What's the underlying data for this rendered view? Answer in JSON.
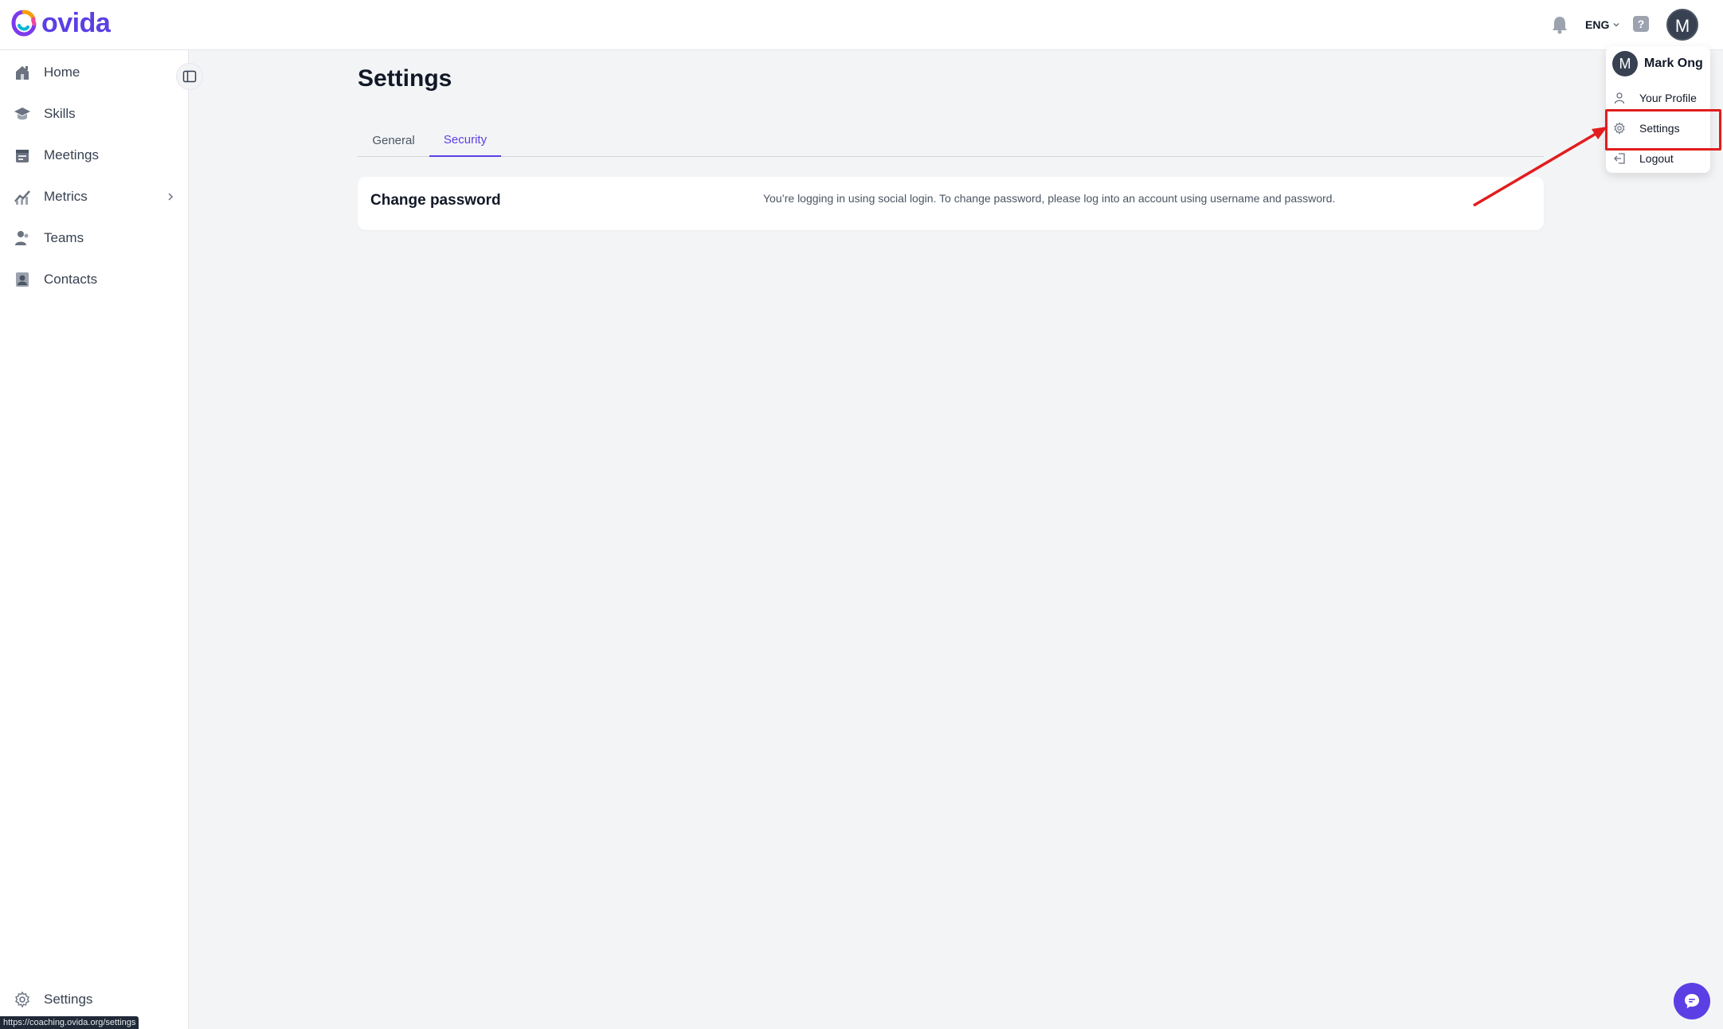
{
  "app": {
    "logo_text": "ovida",
    "brand_color": "#5b3fe4"
  },
  "topbar": {
    "language": "ENG",
    "help_label": "?",
    "avatar_initial": "M"
  },
  "sidebar": {
    "items": [
      {
        "label": "Home",
        "icon": "home-icon"
      },
      {
        "label": "Skills",
        "icon": "graduation-cap-icon"
      },
      {
        "label": "Meetings",
        "icon": "calendar-icon"
      },
      {
        "label": "Metrics",
        "icon": "chart-icon",
        "has_submenu": true
      },
      {
        "label": "Teams",
        "icon": "users-icon"
      },
      {
        "label": "Contacts",
        "icon": "contact-card-icon"
      }
    ],
    "settings_label": "Settings"
  },
  "page": {
    "title": "Settings",
    "tabs": [
      {
        "label": "General",
        "active": false
      },
      {
        "label": "Security",
        "active": true
      }
    ],
    "card": {
      "title": "Change password",
      "message": "You’re logging in using social login. To change password, please log into an account using username and password."
    }
  },
  "user_menu": {
    "avatar_initial": "M",
    "name": "Mark Ong",
    "items": [
      {
        "label": "Your Profile",
        "icon": "user-icon"
      },
      {
        "label": "Settings",
        "icon": "gear-icon"
      },
      {
        "label": "Logout",
        "icon": "logout-icon"
      }
    ]
  },
  "status_bar": {
    "url": "https://coaching.ovida.org/settings"
  },
  "annotation": {
    "color": "#e11d1d"
  }
}
